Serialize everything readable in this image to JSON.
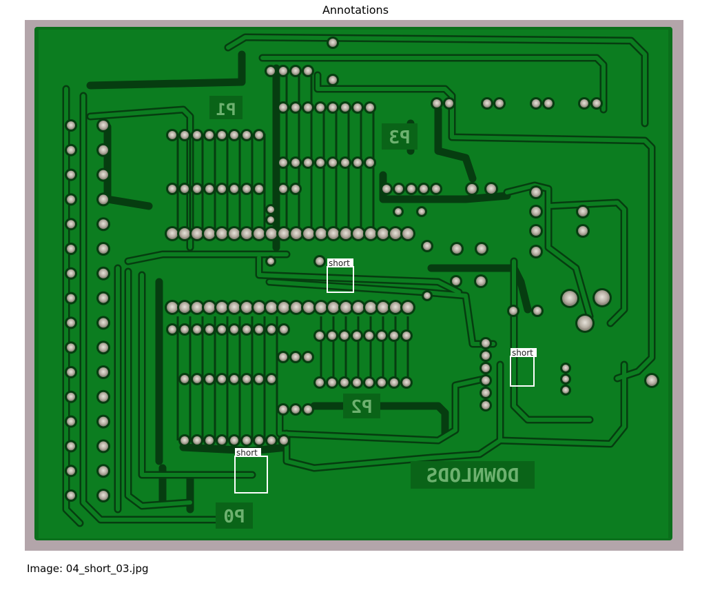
{
  "figure": {
    "title": "Annotations",
    "caption": "Image: 04_short_03.jpg"
  },
  "board": {
    "silkscreen_labels": [
      "P1",
      "P3",
      "P2",
      "P0",
      "DOWNLODS"
    ],
    "colors": {
      "board": "#0b7a1e",
      "trace": "#0e8a24",
      "gap": "#063d10",
      "pad": "#b9b3a8",
      "frame": "#b0a3a8"
    }
  },
  "annotations": [
    {
      "label": "short"
    },
    {
      "label": "short"
    },
    {
      "label": "short"
    }
  ]
}
